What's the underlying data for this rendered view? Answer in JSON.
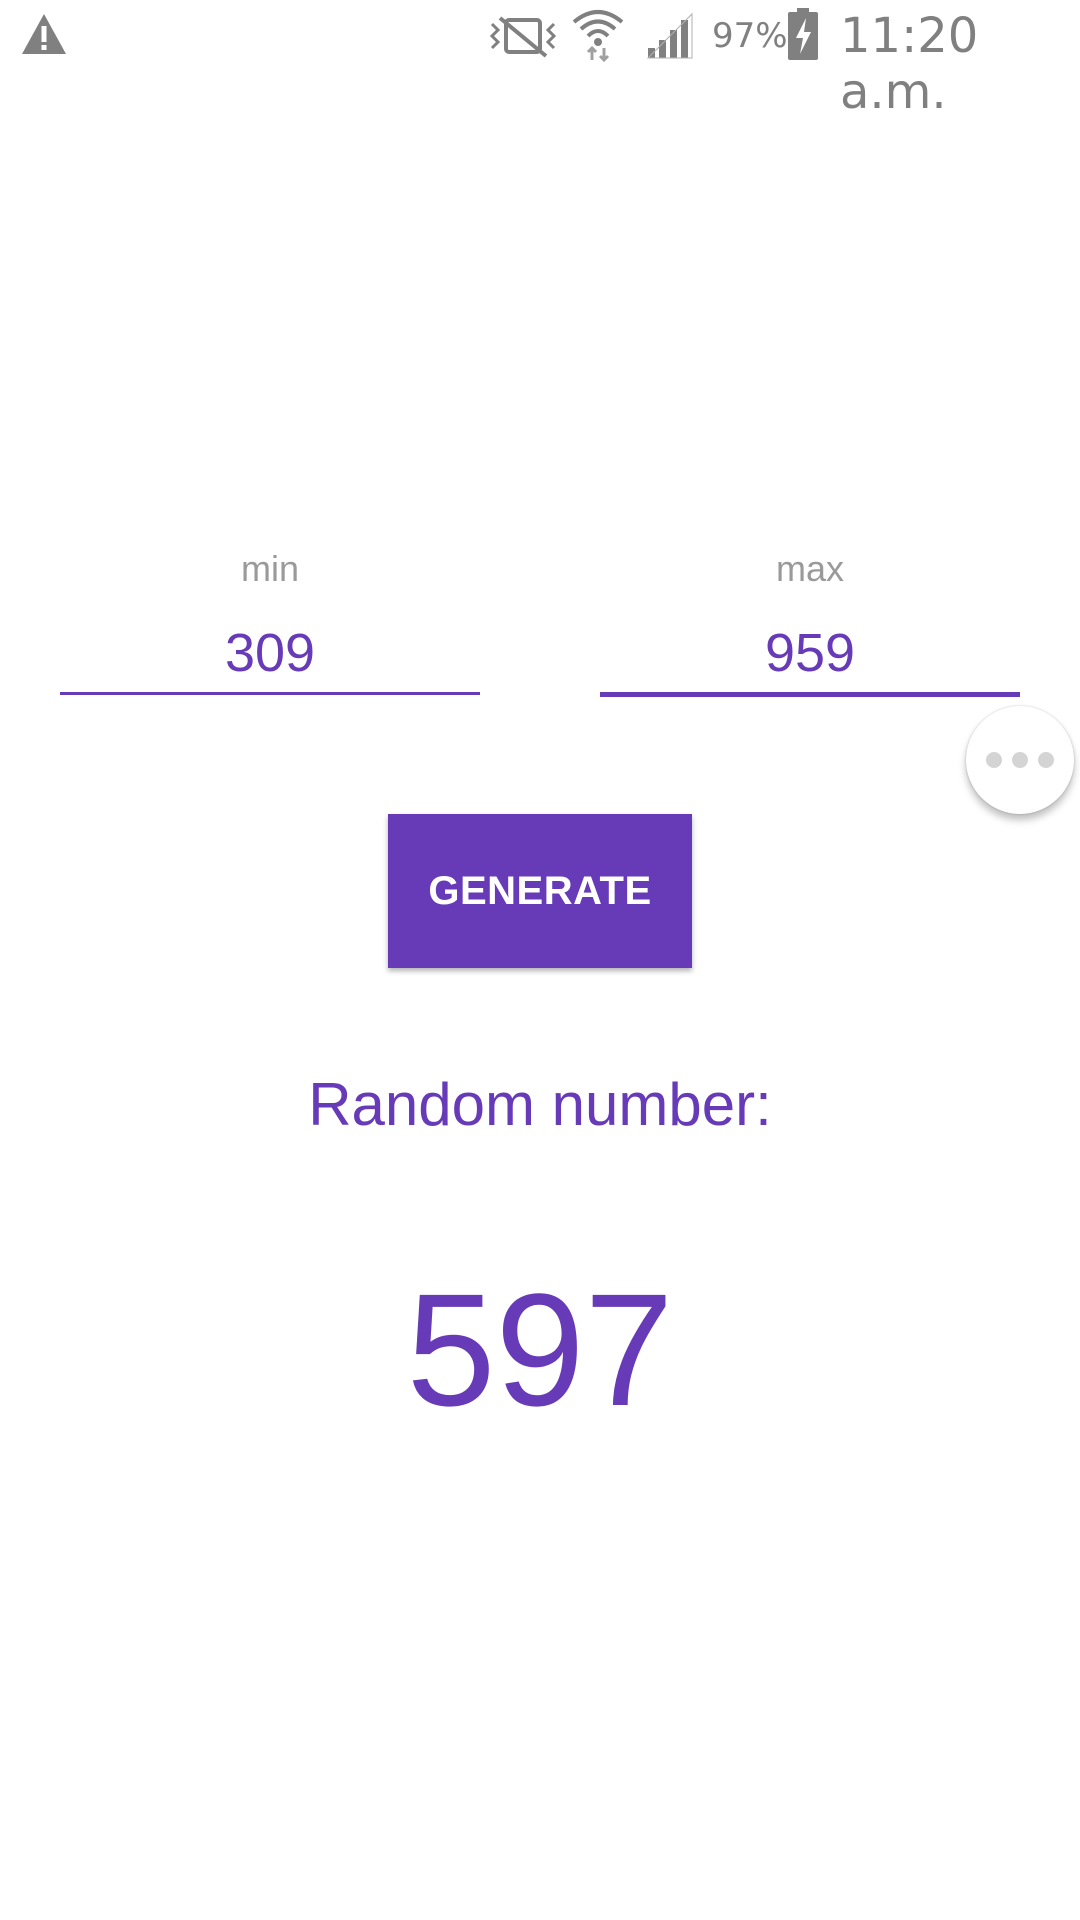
{
  "status_bar": {
    "battery_percent": "97%",
    "time": "11:20 a.m.",
    "icons": [
      "warning-icon",
      "vibrate-off-icon",
      "wifi-icon",
      "signal-icon",
      "battery-charging-icon"
    ]
  },
  "range": {
    "min_label": "min",
    "min_value": "309",
    "max_label": "max",
    "max_value": "959"
  },
  "generate_button": {
    "label": "GENERATE"
  },
  "result": {
    "label": "Random number:",
    "value": "597"
  },
  "colors": {
    "accent": "#673ab7",
    "muted_text": "#9a9a9a",
    "status_icons": "#808080"
  }
}
